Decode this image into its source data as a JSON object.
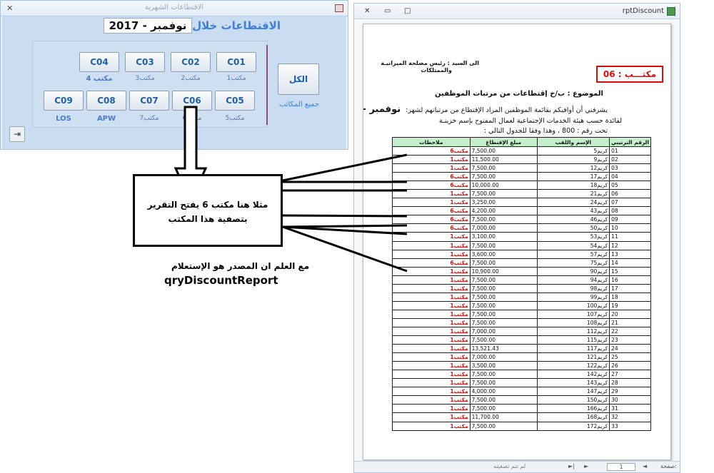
{
  "form": {
    "title": "الاقتطاعات الشهرية",
    "close_glyph": "✕",
    "header_label": "الاقتطاعات خلال شهر",
    "month_value": "نوفمبر - 2017",
    "buttons": [
      {
        "code": "C04",
        "label": "مكتب 4"
      },
      {
        "code": "C03",
        "label": "مكتب3"
      },
      {
        "code": "C02",
        "label": "مكتب2"
      },
      {
        "code": "C01",
        "label": "مكتب1"
      },
      {
        "code": "C09",
        "label": "LOS"
      },
      {
        "code": "C08",
        "label": "APW"
      },
      {
        "code": "C07",
        "label": "مكتب7"
      },
      {
        "code": "C06",
        "label": "مكتب6"
      },
      {
        "code": "C05",
        "label": "مكتب5"
      }
    ],
    "all_button": "الكل",
    "all_label": "جميع المكاتب",
    "exit_glyph": "⇥"
  },
  "report": {
    "window_title": "rptDiscount",
    "close_glyph": "✕",
    "min_glyph": "▭",
    "max_glyph": "□",
    "addressee": "الى السيد : رئيس مصلحة الميزانيـة",
    "addressee2": "والممتلكات",
    "office_label": "مكتـــب :",
    "office_value": "06",
    "subject": "الموضوع : ب/خ إقتطاعات من مرتبات الموظفين",
    "line1": "يشرفني أن أوافيكم بقائمة الموظفين المراد الإقتطاع من مرتباتهم لشهر:",
    "line1_month": "نوفمبر - 2017",
    "line2": "لفائدة حسب هيئة الخدمات الإجتماعية لعمال        المفتوح بإسم خزينـة",
    "line3": "تحت رقم : 800 ، وهذا وفقا للجدول التالي :",
    "columns": [
      "ملاحظات",
      "مبلغ الإقتطاع",
      "الإسم واللقب",
      "الرقم الترتيبي"
    ],
    "rows": [
      [
        "مكتب6",
        "7,500.00",
        "كريم5",
        "01"
      ],
      [
        "مكتب1",
        "11,500.00",
        "كريم9",
        "02"
      ],
      [
        "مكتب1",
        "7,500.00",
        "كريم12",
        "03"
      ],
      [
        "مكتب6",
        "7,500.00",
        "كريم17",
        "04"
      ],
      [
        "مكتب6",
        "10,000.00",
        "كريم18",
        "05"
      ],
      [
        "مكتب1",
        "7,500.00",
        "كريم21",
        "06"
      ],
      [
        "مكتب1",
        "3,250.00",
        "كريم24",
        "07"
      ],
      [
        "مكتب6",
        "4,200.00",
        "كريم43",
        "08"
      ],
      [
        "مكتب6",
        "7,500.00",
        "كريم46",
        "09"
      ],
      [
        "مكتب6",
        "7,000.00",
        "كريم50",
        "10"
      ],
      [
        "مكتب1",
        "3,100.00",
        "كريم53",
        "11"
      ],
      [
        "مكتب1",
        "7,500.00",
        "كريم54",
        "12"
      ],
      [
        "مكتب1",
        "3,600.00",
        "كريم57",
        "13"
      ],
      [
        "مكتب6",
        "7,500.00",
        "كريم75",
        "14"
      ],
      [
        "مكتب1",
        "10,900.00",
        "كريم90",
        "15"
      ],
      [
        "مكتب1",
        "7,500.00",
        "كريم94",
        "16"
      ],
      [
        "مكتب1",
        "7,500.00",
        "كريم98",
        "17"
      ],
      [
        "مكتب1",
        "7,500.00",
        "كريم99",
        "18"
      ],
      [
        "مكتب1",
        "7,500.00",
        "كريم100",
        "19"
      ],
      [
        "مكتب1",
        "7,500.00",
        "كريم107",
        "20"
      ],
      [
        "مكتب1",
        "7,500.00",
        "كريم108",
        "21"
      ],
      [
        "مكتب1",
        "7,000.00",
        "كريم112",
        "22"
      ],
      [
        "مكتب1",
        "7,500.00",
        "كريم115",
        "23"
      ],
      [
        "مكتب1",
        "13,521.43",
        "كريم117",
        "24"
      ],
      [
        "مكتب1",
        "7,000.00",
        "كريم121",
        "25"
      ],
      [
        "مكتب1",
        "3,500.00",
        "كريم122",
        "26"
      ],
      [
        "مكتب1",
        "7,500.00",
        "كريم142",
        "27"
      ],
      [
        "مكتب1",
        "7,500.00",
        "كريم143",
        "28"
      ],
      [
        "مكتب1",
        "4,000.00",
        "كريم147",
        "29"
      ],
      [
        "مكتب1",
        "7,500.00",
        "كريم150",
        "30"
      ],
      [
        "مكتب1",
        "7,500.00",
        "كريم166",
        "31"
      ],
      [
        "مكتب1",
        "11,700.00",
        "كريم168",
        "32"
      ],
      [
        "مكتب1",
        "7,500.00",
        "كريم172",
        "33"
      ]
    ],
    "status": {
      "page_label": "صفحة:",
      "page_value": "1",
      "filter_label": "لم تتم تصفيته",
      "nav_first": "|◄",
      "nav_prev": "◄",
      "nav_next": "►",
      "nav_last": "►|"
    }
  },
  "annotation": {
    "callout_line1": "مثلا هنا مكتب 6 يفتح التقرير",
    "callout_line2": "بتصفية هذا المكتب",
    "note_line1": "مع العلم ان المصدر هو الإستعلام",
    "note_line2": "qryDiscountReport"
  }
}
